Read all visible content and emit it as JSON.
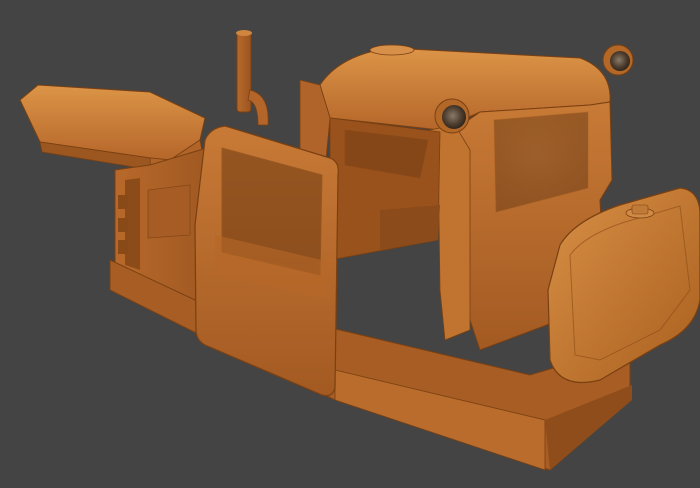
{
  "viewport": {
    "background_color": "#444444"
  },
  "model": {
    "name": "",
    "material_color": "#c0702a",
    "shadow_color": "#7a4012",
    "highlight_color": "#e09a50",
    "glass_color": "#5d4a3a"
  }
}
